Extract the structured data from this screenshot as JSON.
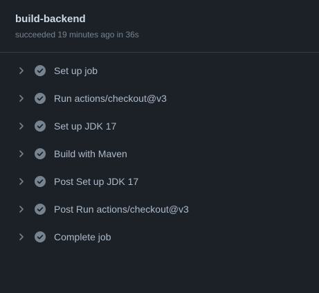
{
  "job": {
    "title": "build-backend",
    "status": "succeeded 19 minutes ago in 36s"
  },
  "icons": {
    "chevron": "chevron-right-icon",
    "check": "check-circle-icon"
  },
  "colors": {
    "background": "#1c2128",
    "title": "#cdd9e5",
    "muted": "#768390",
    "step_text": "#adbac7",
    "icon": "#768390"
  },
  "steps": [
    {
      "label": "Set up job"
    },
    {
      "label": "Run actions/checkout@v3"
    },
    {
      "label": "Set up JDK 17"
    },
    {
      "label": "Build with Maven"
    },
    {
      "label": "Post Set up JDK 17"
    },
    {
      "label": "Post Run actions/checkout@v3"
    },
    {
      "label": "Complete job"
    }
  ]
}
